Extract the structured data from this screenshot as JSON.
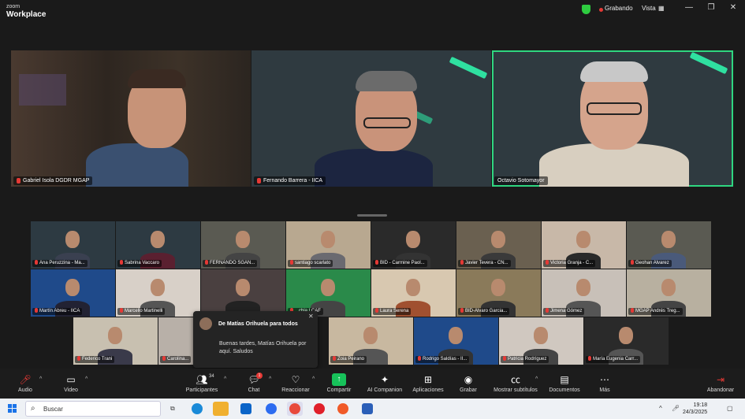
{
  "app": {
    "logo_top": "zoom",
    "logo_bottom": "Workplace",
    "recording_label": "Grabando",
    "view_label": "Vista"
  },
  "speakers": [
    {
      "name": "Gabriel Isola DGDR MGAP",
      "muted": true
    },
    {
      "name": "Fernando Barrera - IICA",
      "muted": true
    },
    {
      "name": "Octavio Sotomayor",
      "muted": false,
      "active": true
    }
  ],
  "gallery": [
    {
      "name": "Ana Peruzzina - Ma..."
    },
    {
      "name": "Sabrina Vaccaro"
    },
    {
      "name": "FERNANDO SGAN..."
    },
    {
      "name": "santiago scarlato"
    },
    {
      "name": "BID - Carmine Paol..."
    },
    {
      "name": "Javier Tevera - CN..."
    },
    {
      "name": "Victoria Granja - C..."
    },
    {
      "name": "Geohan Alvarez"
    },
    {
      "name": "Martín Abreu - IICA"
    },
    {
      "name": "Marcello Martinelli"
    },
    {
      "name": ""
    },
    {
      "name": "...chia | CAF"
    },
    {
      "name": "Laura Serena"
    },
    {
      "name": "BID-Alvaro Garcia..."
    },
    {
      "name": "Jimena Gómez"
    },
    {
      "name": "MGAP Andrés Treg..."
    },
    {
      "name": "Federico Trani"
    },
    {
      "name": "Carolina..."
    },
    {
      "name": "Zoia Peirano"
    },
    {
      "name": "Rodrigo Saldías - II..."
    },
    {
      "name": "Patricia Rodríguez"
    },
    {
      "name": "María Eugenia Carr..."
    }
  ],
  "chat_popup": {
    "from": "De Matías Orihuela para todos",
    "message": "Buenas tardes, Matías Orihuela por aquí. Saludos"
  },
  "toolbar": {
    "audio": "Audio",
    "video": "Video",
    "participants": "Participantes",
    "participants_count": "34",
    "chat": "Chat",
    "chat_badge": "1",
    "react": "Reaccionar",
    "share": "Compartir",
    "ai": "AI Companion",
    "apps": "Aplicaciones",
    "record": "Grabar",
    "subtitles": "Mostrar subtítulos",
    "docs": "Documentos",
    "more": "Más",
    "leave": "Abandonar"
  },
  "taskbar": {
    "search_placeholder": "Buscar",
    "time": "19:18",
    "date": "24/3/2025"
  }
}
